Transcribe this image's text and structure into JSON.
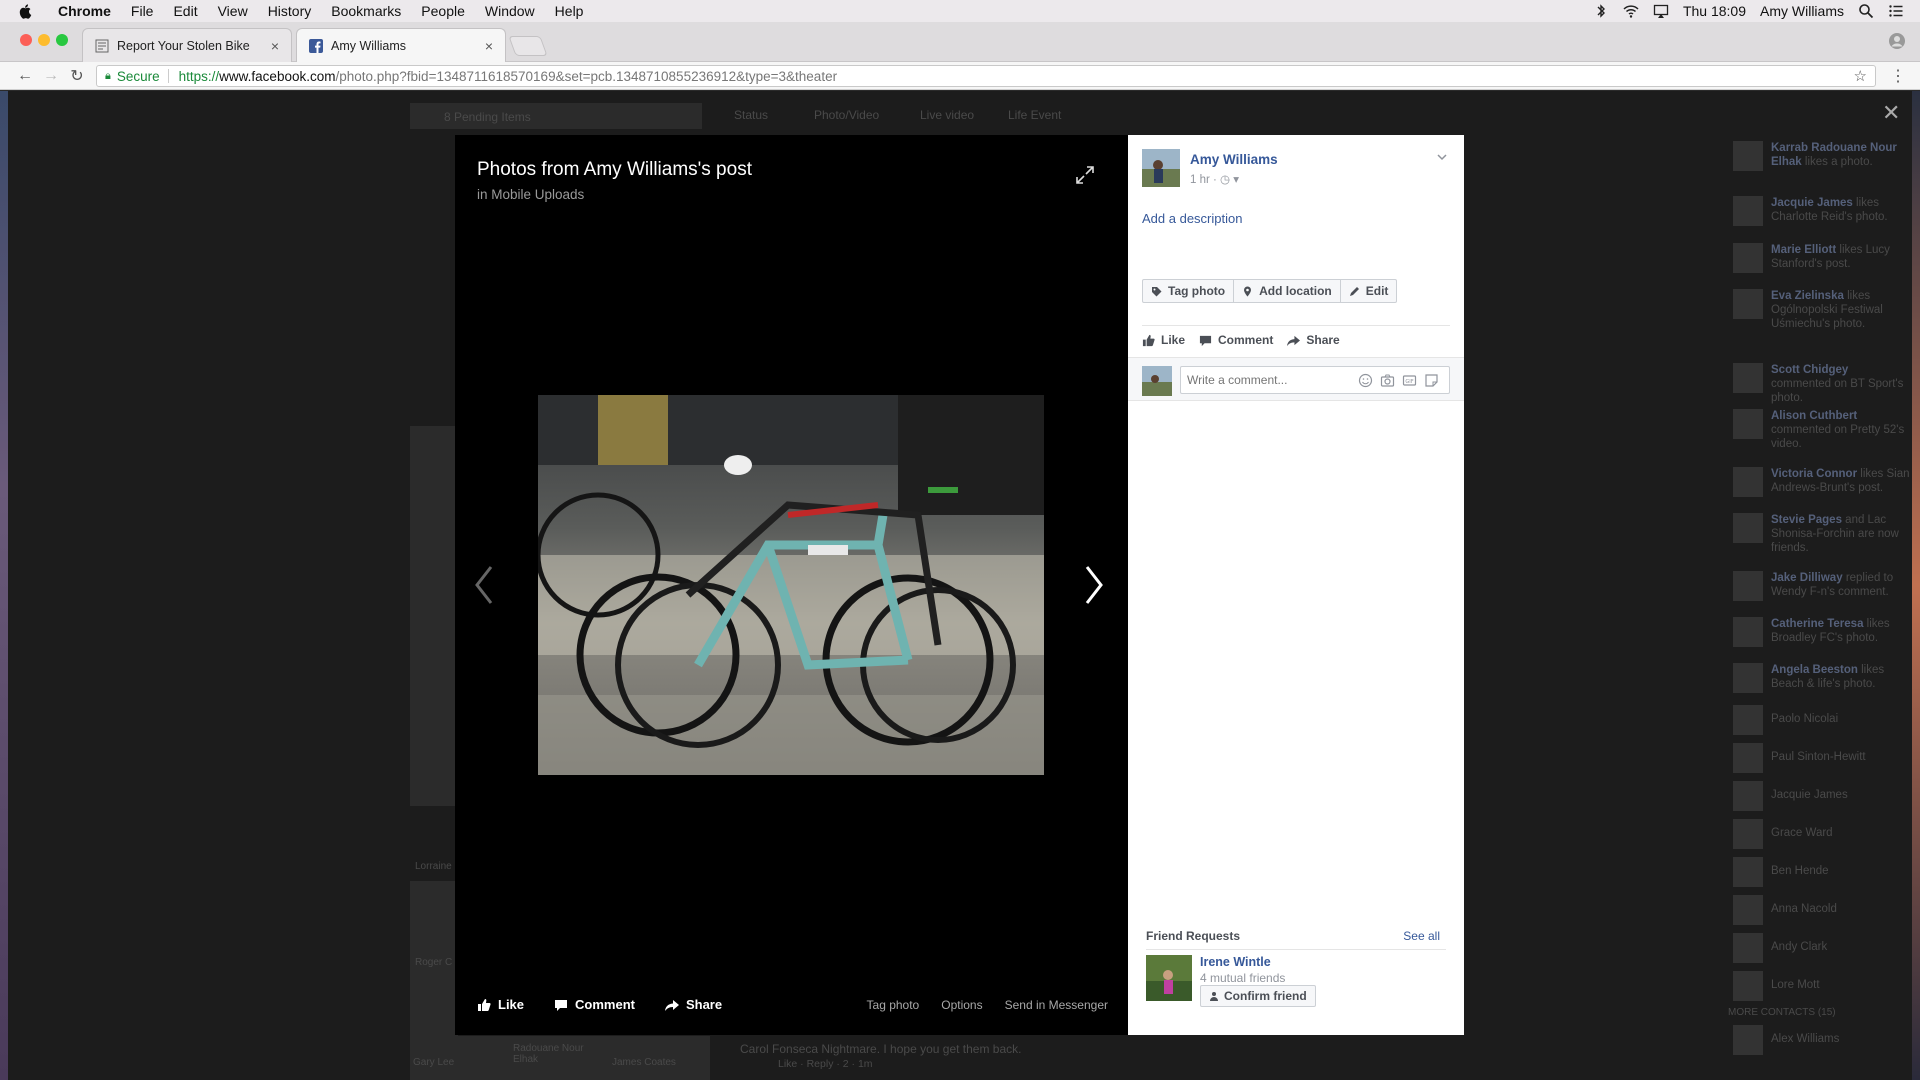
{
  "menubar": {
    "app": "Chrome",
    "items": [
      "File",
      "Edit",
      "View",
      "History",
      "Bookmarks",
      "People",
      "Window",
      "Help"
    ],
    "clock": "Thu 18:09",
    "user": "Amy Williams"
  },
  "tabs": [
    {
      "title": "Report Your Stolen Bike",
      "close": "×"
    },
    {
      "title": "Amy Williams",
      "close": "×"
    }
  ],
  "omnibox": {
    "secure_label": "Secure",
    "url_proto": "https://",
    "url_host": "www.facebook.com",
    "url_rest": "/photo.php?fbid=1348711618570169&set=pcb.1348710855236912&type=3&theater"
  },
  "background": {
    "pending": "8 Pending Items",
    "composer_tabs": [
      "Status",
      "Photo/Video",
      "Live video",
      "Life Event"
    ],
    "bottom_comment": "Carol Fonseca Nightmare. I hope you get them back.",
    "bottom_meta": "Like · Reply · 2 · 1m",
    "tiles": [
      "Gary Lee",
      "Radouane Nour Elhak",
      "James Coates"
    ],
    "side_labels": [
      "Lorraine",
      "Roger C"
    ],
    "ticker": [
      {
        "name": "Karrab Radouane Nour Elhak",
        "text": "likes a photo."
      },
      {
        "name": "Jacquie James",
        "text": "likes Charlotte Reid's photo."
      },
      {
        "name": "Marie Elliott",
        "text": "likes Lucy Stanford's post."
      },
      {
        "name": "Eva Zielinska",
        "text": "likes Ogólnopolski Festiwal Uśmiechu's photo."
      },
      {
        "name": "Scott Chidgey",
        "text": "commented on BT Sport's photo."
      },
      {
        "name": "Alison Cuthbert",
        "text": "commented on Pretty 52's video."
      },
      {
        "name": "Victoria Connor",
        "text": "likes Sian Andrews-Brunt's post."
      },
      {
        "name": "Stevie Pages",
        "text": "and Lac Shonisa-Forchin are now friends."
      },
      {
        "name": "Jake Dilliway",
        "text": "replied to Wendy F-n's comment."
      },
      {
        "name": "Catherine Teresa",
        "text": "likes Broadley FC's photo."
      },
      {
        "name": "Angela Beeston",
        "text": "likes Beach & life's photo."
      }
    ],
    "contacts": [
      "Paolo Nicolai",
      "Paul Sinton-Hewitt",
      "Jacquie James",
      "Grace Ward",
      "Ben Hende",
      "Anna Nacold",
      "Andy Clark",
      "Lore Mott"
    ],
    "more_contacts": "MORE CONTACTS (15)",
    "last_contact": "Alex Williams"
  },
  "theater": {
    "title": "Photos from Amy Williams's post",
    "subtitle": "in Mobile Uploads",
    "actions": {
      "like": "Like",
      "comment": "Comment",
      "share": "Share"
    },
    "options": [
      "Tag photo",
      "Options",
      "Send in Messenger"
    ]
  },
  "panel": {
    "poster_name": "Amy Williams",
    "post_time": "1 hr ·",
    "add_description": "Add a description",
    "tag_buttons": [
      "Tag photo",
      "Add location",
      "Edit"
    ],
    "actions": {
      "like": "Like",
      "comment": "Comment",
      "share": "Share"
    },
    "comment_placeholder": "Write a comment...",
    "friend_requests": {
      "header": "Friend Requests",
      "see_all": "See all",
      "name": "Irene Wintle",
      "mutual": "4 mutual friends",
      "confirm": "Confirm friend"
    }
  },
  "colors": {
    "fb_link": "#365899",
    "stage_bg": "#000000",
    "secure_green": "#1b8a3a"
  }
}
